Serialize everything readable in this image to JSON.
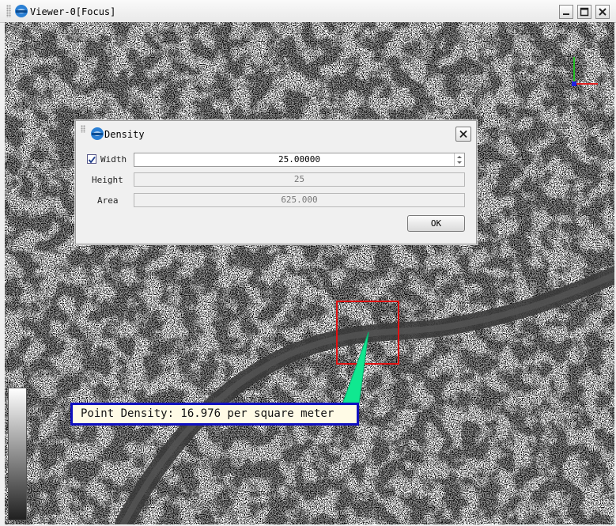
{
  "window": {
    "title": "Viewer-0[Focus]",
    "controls": [
      "minimize-icon",
      "maximize-icon",
      "close-icon"
    ]
  },
  "dialog": {
    "title": "Density",
    "width": {
      "label": "Width",
      "checked": true,
      "value": "25.00000"
    },
    "height": {
      "label": "Height",
      "value": "25"
    },
    "area": {
      "label": "Area",
      "value": "625.000"
    },
    "ok_label": "OK"
  },
  "annotation": {
    "text": "Point Density: 16.976 per square meter",
    "box_color": "#1010c0",
    "selection_color": "#e01010",
    "pointer_color": "#10e890"
  },
  "colors": {
    "road": "#3a3a3a",
    "axis_x": "#e02020",
    "axis_y": "#20c020",
    "axis_z": "#2020e0"
  }
}
